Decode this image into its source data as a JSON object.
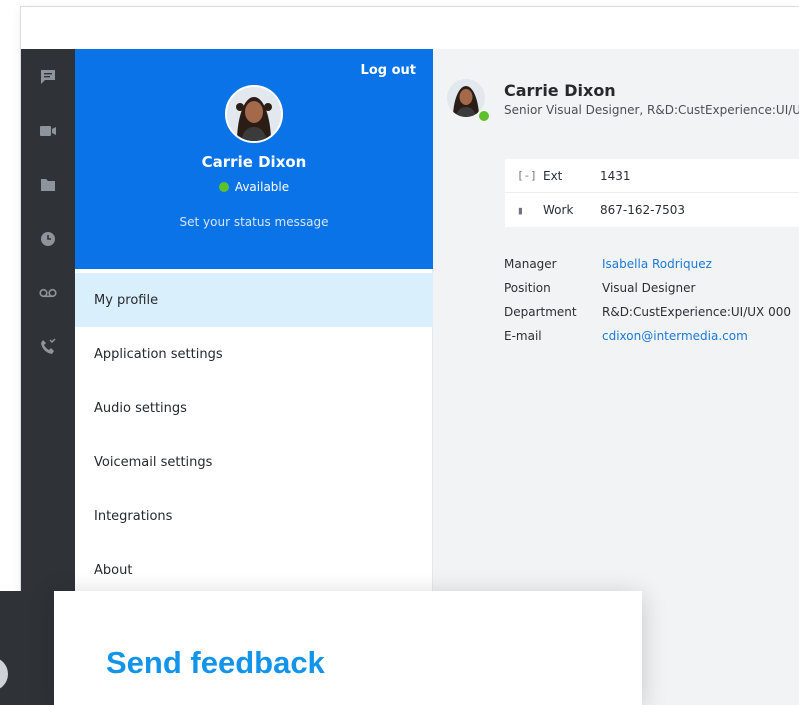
{
  "profile": {
    "name": "Carrie Dixon",
    "status": "Available",
    "status_message_placeholder": "Set your status message",
    "logout_label": "Log out",
    "title": "Senior Visual Designer, R&D:CustExperience:UI/UX",
    "status_color": "#5ec12b"
  },
  "rail": {
    "icons": [
      "chat-icon",
      "video-icon",
      "folder-icon",
      "clock-icon",
      "voicemail-icon",
      "phone-call-icon"
    ]
  },
  "menu": {
    "items": [
      {
        "label": "My profile",
        "active": true
      },
      {
        "label": "Application settings",
        "active": false
      },
      {
        "label": "Audio settings",
        "active": false
      },
      {
        "label": "Voicemail settings",
        "active": false
      },
      {
        "label": "Integrations",
        "active": false
      },
      {
        "label": "About",
        "active": false
      }
    ]
  },
  "phones": [
    {
      "icon": "[-]",
      "label": "Ext",
      "value": "1431"
    },
    {
      "icon": "▮",
      "label": "Work",
      "value": "867-162-7503"
    }
  ],
  "info": {
    "manager_label": "Manager",
    "manager": "Isabella Rodriquez",
    "position_label": "Position",
    "position": "Visual Designer",
    "department_label": "Department",
    "department": "R&D:CustExperience:UI/UX 000",
    "email_label": "E-mail",
    "email": "cdixon@intermedia.com"
  },
  "feedback": {
    "title": "Send feedback"
  },
  "colors": {
    "accent": "#0a73e8",
    "link": "#1a7ad9",
    "rail": "#2f3337",
    "active_menu": "#d9effc",
    "feedback_title": "#1294ea"
  }
}
